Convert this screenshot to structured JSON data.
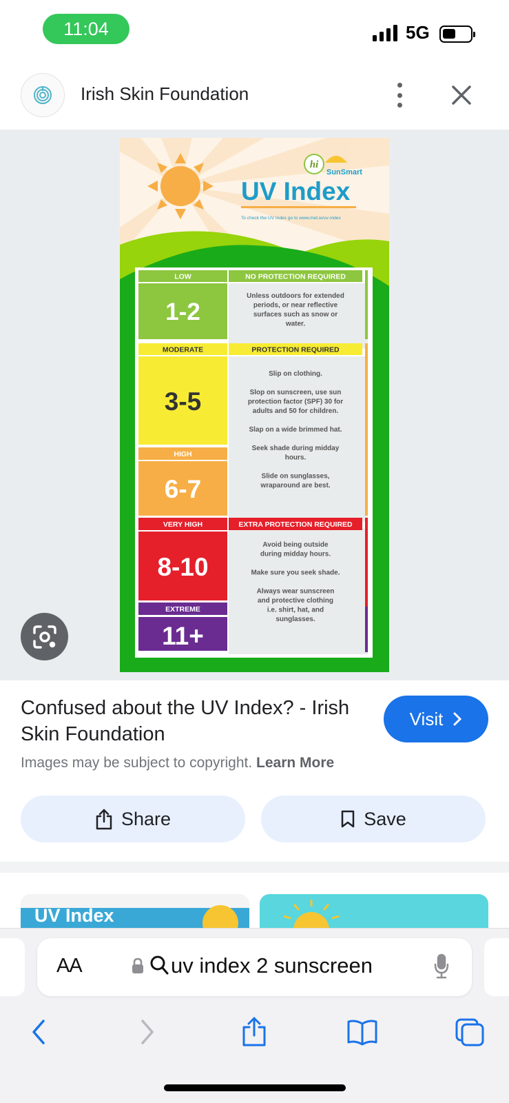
{
  "status_bar": {
    "time": "11:04",
    "network": "5G",
    "battery_level": 0.35
  },
  "header": {
    "site_name": "Irish Skin Foundation"
  },
  "poster": {
    "title": "UV Index",
    "brand_hi": "hi",
    "brand_sunsmart": "SunSmart",
    "subtitle": "To check the UV Index go to www.met.ie/uv-index",
    "levels": [
      {
        "label": "LOW",
        "range": "1-2"
      },
      {
        "label": "MODERATE",
        "range": "3-5"
      },
      {
        "label": "HIGH",
        "range": "6-7"
      },
      {
        "label": "VERY HIGH",
        "range": "8-10"
      },
      {
        "label": "EXTREME",
        "range": "11+"
      }
    ],
    "advice": [
      {
        "heading": "NO PROTECTION REQUIRED",
        "lines": [
          "Unless outdoors for extended",
          "periods, or near reflective",
          "surfaces such as snow or",
          "water."
        ]
      },
      {
        "heading": "PROTECTION REQUIRED",
        "lines": [
          "Slip on clothing.",
          "",
          "Slop on sunscreen, use sun",
          "protection factor (SPF) 30 for",
          "adults and 50 for children.",
          "",
          "Slap on a wide brimmed hat.",
          "",
          "Seek shade during midday",
          "hours.",
          "",
          "Slide on sunglasses,",
          "wraparound are best."
        ]
      },
      {
        "heading": "EXTRA PROTECTION REQUIRED",
        "lines": [
          "Avoid being outside",
          "during midday hours.",
          "",
          "Make sure you seek shade.",
          "",
          "Always wear sunscreen",
          "and protective clothing",
          "i.e. shirt, hat, and",
          "sunglasses."
        ]
      }
    ],
    "colors": {
      "low": "#8dc63f",
      "moderate": "#f7ec33",
      "high": "#f7ae46",
      "very_high": "#e5202b",
      "extreme": "#6b2c91",
      "grass": "#1aab1a",
      "title": "#1e9cc9"
    }
  },
  "result": {
    "title": "Confused about the UV Index? - Irish Skin Foundation",
    "visit_label": "Visit",
    "copyright_text": "Images may be subject to copyright.",
    "learn_more": "Learn More",
    "share_label": "Share",
    "save_label": "Save"
  },
  "related": {
    "thumb1_label": "UV Index"
  },
  "toolbar": {
    "aa_label": "AA",
    "query": "uv index 2 sunscreen"
  },
  "icons": [
    "fingerprint-icon",
    "more-vert-icon",
    "close-icon",
    "lens-icon",
    "chevron-right-icon",
    "share-icon",
    "bookmark-icon",
    "lock-icon",
    "search-icon",
    "mic-icon",
    "back-icon",
    "forward-icon",
    "safari-share-icon",
    "bookmarks-icon",
    "tabs-icon"
  ]
}
